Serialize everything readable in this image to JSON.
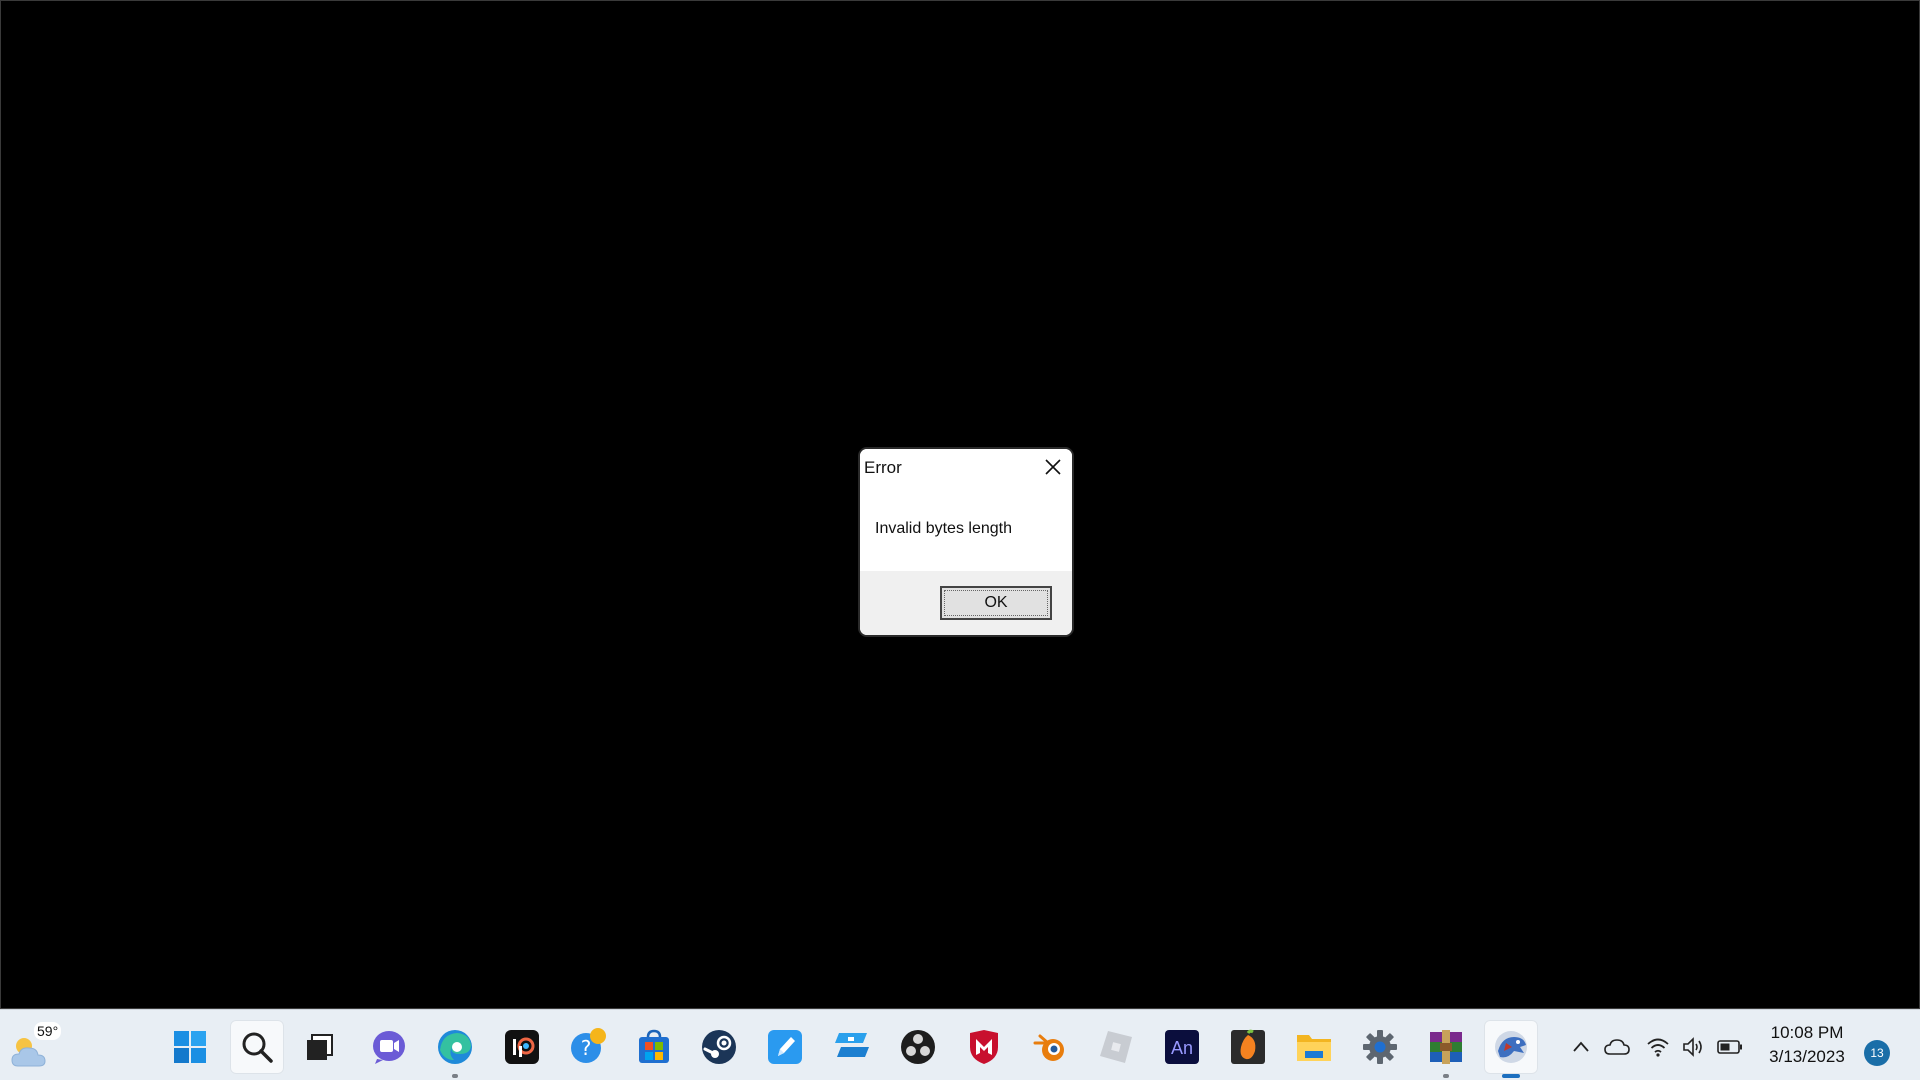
{
  "dialog": {
    "title": "Error",
    "message": "Invalid bytes length",
    "ok_label": "OK"
  },
  "taskbar": {
    "weather": {
      "temp": "59°",
      "icon": "partly-cloudy-icon"
    },
    "apps": [
      {
        "name": "start",
        "icon": "windows-logo-icon"
      },
      {
        "name": "search",
        "icon": "search-icon"
      },
      {
        "name": "task-view",
        "icon": "task-view-icon"
      },
      {
        "name": "teams-chat",
        "icon": "video-chat-icon"
      },
      {
        "name": "edge",
        "icon": "edge-icon",
        "running": true
      },
      {
        "name": "ibispaint",
        "icon": "ibispaint-icon"
      },
      {
        "name": "get-help",
        "icon": "help-icon"
      },
      {
        "name": "microsoft-store",
        "icon": "store-icon"
      },
      {
        "name": "steam",
        "icon": "steam-icon"
      },
      {
        "name": "pen-app",
        "icon": "pen-icon"
      },
      {
        "name": "roblox-studio",
        "icon": "roblox-studio-icon"
      },
      {
        "name": "obs-studio",
        "icon": "obs-icon"
      },
      {
        "name": "mcafee",
        "icon": "mcafee-icon"
      },
      {
        "name": "blender",
        "icon": "blender-icon"
      },
      {
        "name": "roblox",
        "icon": "roblox-icon"
      },
      {
        "name": "animate",
        "icon": "animate-icon",
        "label": "An"
      },
      {
        "name": "fl-studio",
        "icon": "fl-studio-icon"
      },
      {
        "name": "file-explorer",
        "icon": "folder-icon"
      },
      {
        "name": "settings",
        "icon": "gear-icon"
      },
      {
        "name": "winrar",
        "icon": "winrar-icon",
        "running": true
      },
      {
        "name": "active-app",
        "icon": "dragon-app-icon",
        "active": true
      }
    ],
    "tray": {
      "icons": [
        "chevron-up-icon",
        "onedrive-cloud-icon",
        "wifi-icon",
        "volume-icon",
        "battery-icon"
      ]
    },
    "clock": {
      "time": "10:08 PM",
      "date": "3/13/2023"
    },
    "notification_count": "13"
  }
}
